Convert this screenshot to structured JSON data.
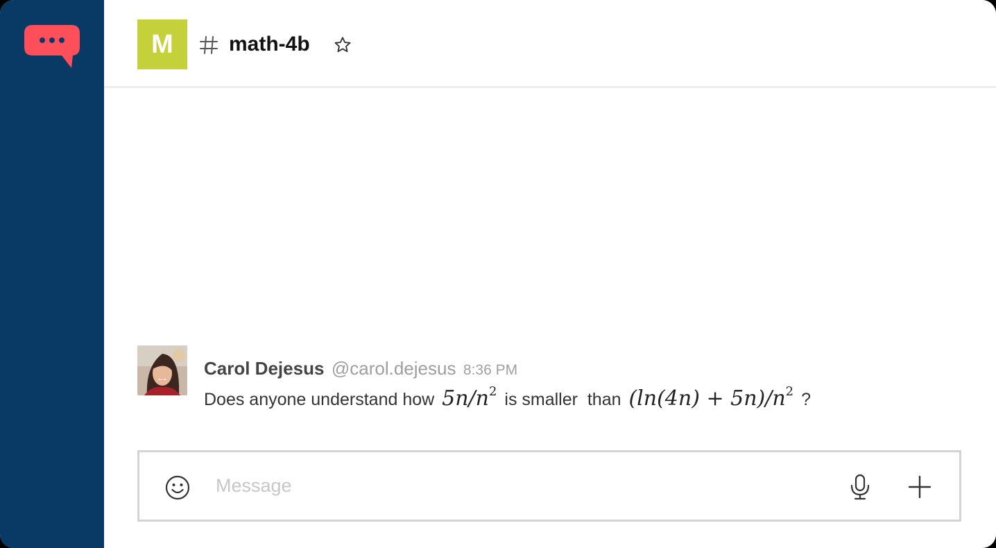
{
  "channel": {
    "avatar_letter": "M",
    "avatar_color": "#c5d13b",
    "name": "math-4b",
    "hash_icon": "hash-icon",
    "star_icon": "star-outline-icon"
  },
  "sidebar": {
    "background": "#083a65",
    "logo_icon": "chat-bubble-logo-icon",
    "logo_color": "#ff4f5a"
  },
  "message": {
    "author": "Carol Dejesus",
    "handle": "@carol.dejesus",
    "time": "8:36 PM",
    "text_before": "Does anyone understand how",
    "math_1": "5n/n",
    "math_1_exp": "2",
    "text_middle": "is smaller  than",
    "math_2": "(ln(4n) + 5n)/n",
    "math_2_exp": "2",
    "text_after": "?"
  },
  "composer": {
    "placeholder": "Message",
    "value": "",
    "emoji_icon": "emoji-smile-icon",
    "mic_icon": "microphone-icon",
    "plus_icon": "plus-icon"
  }
}
